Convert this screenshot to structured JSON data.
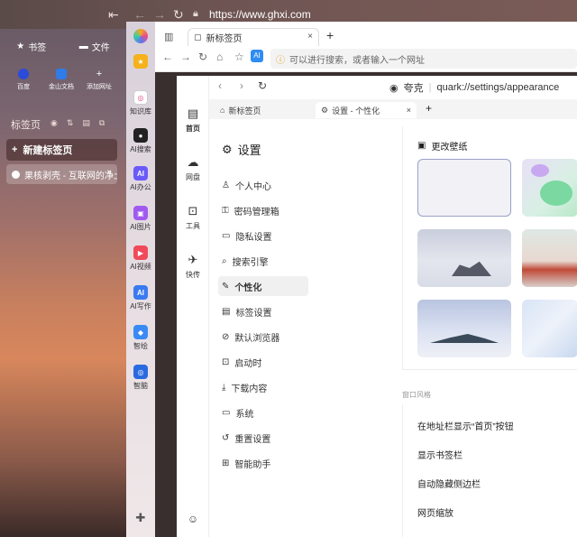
{
  "outer": {
    "url": "https://www.ghxi.com"
  },
  "left_panel": {
    "bookmarks_label": "书签",
    "files_label": "文件",
    "quick_links": [
      {
        "label": "百度",
        "color": "#2b4bd8"
      },
      {
        "label": "金山文档",
        "color": "#2f7be8"
      },
      {
        "label": "添加网址",
        "color": "transparent"
      }
    ],
    "tabs_label": "标签页",
    "new_tab_label": "新建标签页",
    "page_tab_label": "果核剥壳 - 互联网的净土"
  },
  "apps": [
    {
      "label": "知识库",
      "color": "#e7e3f0",
      "glyph": "◎"
    },
    {
      "label": "AI搜索",
      "color": "#222222",
      "glyph": "●"
    },
    {
      "label": "AI办公",
      "color": "#6a5af9",
      "glyph": "AI"
    },
    {
      "label": "AI图片",
      "color": "#a05af0",
      "glyph": "▣"
    },
    {
      "label": "AI视频",
      "color": "#f04a5a",
      "glyph": "▶"
    },
    {
      "label": "AI写作",
      "color": "#3a7af0",
      "glyph": "AI"
    },
    {
      "label": "智绘",
      "color": "#3a8af5",
      "glyph": "◆"
    },
    {
      "label": "智脑",
      "color": "#2a6ae0",
      "glyph": "◎"
    }
  ],
  "chrome": {
    "tab_label": "新标签页",
    "address_placeholder": "可以进行搜索，或者输入一个网址"
  },
  "vnav": [
    {
      "label": "首页"
    },
    {
      "label": "网盘"
    },
    {
      "label": "工具"
    },
    {
      "label": "快传"
    }
  ],
  "inner": {
    "search_engine": "夸克",
    "url": "quark://settings/appearance",
    "tabs": [
      {
        "label": "新标签页"
      },
      {
        "label": "设置 - 个性化"
      }
    ]
  },
  "settings": {
    "title": "设置",
    "menu": [
      {
        "label": "个人中心",
        "icon": "user-icon",
        "glyph": "♙"
      },
      {
        "label": "密码管理箱",
        "icon": "key-icon",
        "glyph": "⚿"
      },
      {
        "label": "隐私设置",
        "icon": "privacy-icon",
        "glyph": "▭"
      },
      {
        "label": "搜索引擎",
        "icon": "search-icon",
        "glyph": "⌕"
      },
      {
        "label": "个性化",
        "icon": "personalize-icon",
        "glyph": "✎"
      },
      {
        "label": "标签设置",
        "icon": "tab-icon",
        "glyph": "▤"
      },
      {
        "label": "默认浏览器",
        "icon": "default-browser-icon",
        "glyph": "⊘"
      },
      {
        "label": "启动时",
        "icon": "startup-icon",
        "glyph": "⊡"
      },
      {
        "label": "下载内容",
        "icon": "download-icon",
        "glyph": "⤓"
      },
      {
        "label": "系统",
        "icon": "system-icon",
        "glyph": "▭"
      },
      {
        "label": "重置设置",
        "icon": "reset-icon",
        "glyph": "↺"
      },
      {
        "label": "智能助手",
        "icon": "assistant-icon",
        "glyph": "⊞"
      }
    ],
    "active_index": 4,
    "wallpaper_title": "更改壁纸",
    "window_style_label": "窗口风格",
    "options": [
      "在地址栏显示“首页”按钮",
      "显示书签栏",
      "自动隐藏侧边栏",
      "网页缩放"
    ]
  }
}
